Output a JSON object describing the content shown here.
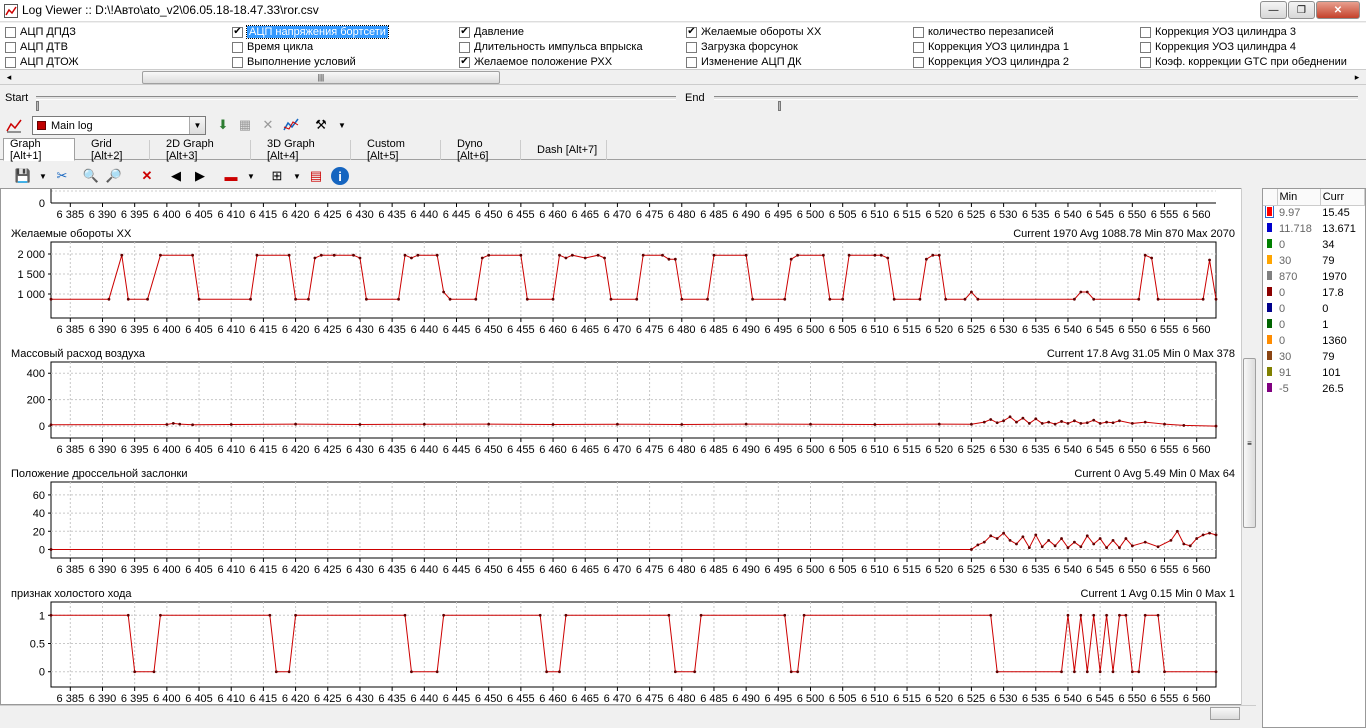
{
  "window": {
    "title": "Log Viewer :: D:\\!Авто\\ato_v2\\06.05.18-18.47.33\\ror.csv",
    "buttons": [
      "—",
      "❐",
      "✕"
    ]
  },
  "checkboxes": [
    {
      "label": "АЦП ДПДЗ",
      "checked": false
    },
    {
      "label": "АЦП ДТВ",
      "checked": false
    },
    {
      "label": "АЦП ДТОЖ",
      "checked": false
    },
    {
      "label": "АЦП напряжения бортсети",
      "checked": true,
      "selected": true
    },
    {
      "label": "Время цикла",
      "checked": false
    },
    {
      "label": "Выполнение условий",
      "checked": false
    },
    {
      "label": "Давление",
      "checked": true
    },
    {
      "label": "Длительность импульса впрыска",
      "checked": false
    },
    {
      "label": "Желаемое положение РХХ",
      "checked": true
    },
    {
      "label": "Желаемые обороты ХХ",
      "checked": true
    },
    {
      "label": "Загрузка форсунок",
      "checked": false
    },
    {
      "label": "Изменение АЦП ДК",
      "checked": false
    },
    {
      "label": "количество перезаписей",
      "checked": false
    },
    {
      "label": "Коррекция УОЗ цилиндра 1",
      "checked": false
    },
    {
      "label": "Коррекция УОЗ цилиндра 2",
      "checked": false
    },
    {
      "label": "Коррекция УОЗ цилиндра 3",
      "checked": false
    },
    {
      "label": "Коррекция УОЗ цилиндра 4",
      "checked": false
    },
    {
      "label": "Коэф. коррекции GTC при обеднении",
      "checked": false
    }
  ],
  "range": {
    "start_label": "Start",
    "end_label": "End"
  },
  "toolbar": {
    "log_selector": "Main log"
  },
  "tabs": [
    "Graph [Alt+1]",
    "Grid [Alt+2]",
    "2D Graph [Alt+3]",
    "3D Graph [Alt+4]",
    "Custom [Alt+5]",
    "Dyno [Alt+6]",
    "Dash [Alt+7]"
  ],
  "active_tab": 0,
  "colors": {
    "series": "#cc0000",
    "grid": "#c8c8c8",
    "selection": "#3399ff"
  },
  "xticks": [
    "6 385",
    "6 390",
    "6 395",
    "6 400",
    "6 405",
    "6 410",
    "6 415",
    "6 420",
    "6 425",
    "6 430",
    "6 435",
    "6 440",
    "6 445",
    "6 450",
    "6 455",
    "6 460",
    "6 465",
    "6 470",
    "6 475",
    "6 480",
    "6 485",
    "6 490",
    "6 495",
    "6 500",
    "6 505",
    "6 510",
    "6 515",
    "6 520",
    "6 525",
    "6 530",
    "6 535",
    "6 540",
    "6 545",
    "6 550",
    "6 555",
    "6 560"
  ],
  "top_panel": {
    "ytick": "0"
  },
  "chart_data": [
    {
      "type": "line",
      "title": "Желаемые обороты ХХ",
      "stats": "Current 1970 Avg 1088.78 Min 870 Max 2070",
      "yticks": [
        "2 000",
        "1 500",
        "1 000"
      ],
      "ylim": [
        500,
        2250
      ],
      "xlim": [
        6382,
        6563
      ],
      "series": [
        {
          "values": [
            [
              6382,
              870
            ],
            [
              6391,
              870
            ],
            [
              6393,
              1970
            ],
            [
              6394,
              870
            ],
            [
              6397,
              870
            ],
            [
              6399,
              1970
            ],
            [
              6404,
              1970
            ],
            [
              6405,
              870
            ],
            [
              6413,
              870
            ],
            [
              6414,
              1970
            ],
            [
              6419,
              1970
            ],
            [
              6420,
              870
            ],
            [
              6422,
              870
            ],
            [
              6423,
              1900
            ],
            [
              6424,
              1970
            ],
            [
              6426,
              1970
            ],
            [
              6429,
              1970
            ],
            [
              6430,
              1900
            ],
            [
              6431,
              870
            ],
            [
              6436,
              870
            ],
            [
              6437,
              1970
            ],
            [
              6438,
              1900
            ],
            [
              6439,
              1970
            ],
            [
              6442,
              1970
            ],
            [
              6443,
              1050
            ],
            [
              6444,
              870
            ],
            [
              6448,
              870
            ],
            [
              6449,
              1900
            ],
            [
              6450,
              1970
            ],
            [
              6455,
              1970
            ],
            [
              6456,
              870
            ],
            [
              6460,
              870
            ],
            [
              6461,
              1970
            ],
            [
              6462,
              1900
            ],
            [
              6463,
              1970
            ],
            [
              6465,
              1900
            ],
            [
              6467,
              1970
            ],
            [
              6468,
              1900
            ],
            [
              6469,
              870
            ],
            [
              6473,
              870
            ],
            [
              6474,
              1970
            ],
            [
              6477,
              1970
            ],
            [
              6478,
              1870
            ],
            [
              6479,
              1870
            ],
            [
              6480,
              870
            ],
            [
              6484,
              870
            ],
            [
              6485,
              1970
            ],
            [
              6490,
              1970
            ],
            [
              6491,
              870
            ],
            [
              6496,
              870
            ],
            [
              6497,
              1870
            ],
            [
              6498,
              1970
            ],
            [
              6502,
              1970
            ],
            [
              6503,
              870
            ],
            [
              6505,
              870
            ],
            [
              6506,
              1970
            ],
            [
              6510,
              1970
            ],
            [
              6511,
              1970
            ],
            [
              6512,
              1900
            ],
            [
              6513,
              870
            ],
            [
              6517,
              870
            ],
            [
              6518,
              1870
            ],
            [
              6519,
              1970
            ],
            [
              6520,
              1970
            ],
            [
              6521,
              870
            ],
            [
              6524,
              870
            ],
            [
              6525,
              1050
            ],
            [
              6526,
              870
            ],
            [
              6541,
              870
            ],
            [
              6542,
              1050
            ],
            [
              6543,
              1050
            ],
            [
              6544,
              870
            ],
            [
              6551,
              870
            ],
            [
              6552,
              1970
            ],
            [
              6553,
              1900
            ],
            [
              6554,
              870
            ],
            [
              6561,
              870
            ],
            [
              6562,
              1850
            ],
            [
              6563,
              870
            ],
            [
              6570,
              870
            ],
            [
              6571,
              1900
            ],
            [
              6572,
              870
            ],
            [
              6587,
              870
            ]
          ]
        }
      ]
    },
    {
      "type": "line",
      "title": "Массовый расход воздуха",
      "stats": "Current 17.8 Avg 31.05 Min 0 Max 378",
      "yticks": [
        "400",
        "200",
        "0"
      ],
      "ylim": [
        -60,
        470
      ],
      "xlim": [
        6382,
        6563
      ],
      "series": [
        {
          "values": [
            [
              6382,
              10
            ],
            [
              6400,
              12
            ],
            [
              6401,
              20
            ],
            [
              6402,
              15
            ],
            [
              6404,
              10
            ],
            [
              6410,
              12
            ],
            [
              6420,
              15
            ],
            [
              6430,
              12
            ],
            [
              6440,
              14
            ],
            [
              6450,
              15
            ],
            [
              6460,
              12
            ],
            [
              6470,
              14
            ],
            [
              6480,
              12
            ],
            [
              6490,
              15
            ],
            [
              6500,
              14
            ],
            [
              6510,
              12
            ],
            [
              6520,
              15
            ],
            [
              6525,
              14
            ],
            [
              6527,
              30
            ],
            [
              6528,
              50
            ],
            [
              6529,
              25
            ],
            [
              6530,
              40
            ],
            [
              6531,
              70
            ],
            [
              6532,
              30
            ],
            [
              6533,
              60
            ],
            [
              6534,
              20
            ],
            [
              6535,
              55
            ],
            [
              6536,
              20
            ],
            [
              6537,
              30
            ],
            [
              6538,
              15
            ],
            [
              6539,
              35
            ],
            [
              6540,
              20
            ],
            [
              6541,
              40
            ],
            [
              6542,
              20
            ],
            [
              6543,
              25
            ],
            [
              6544,
              45
            ],
            [
              6545,
              20
            ],
            [
              6546,
              30
            ],
            [
              6547,
              25
            ],
            [
              6548,
              40
            ],
            [
              6550,
              20
            ],
            [
              6552,
              30
            ],
            [
              6555,
              15
            ],
            [
              6558,
              5
            ],
            [
              6563,
              0
            ]
          ]
        }
      ]
    },
    {
      "type": "line",
      "title": "Положение дроссельной заслонки",
      "stats": "Current 0 Avg 5.49 Min 0 Max 64",
      "yticks": [
        "60",
        "40",
        "20",
        "0"
      ],
      "ylim": [
        -5,
        72
      ],
      "xlim": [
        6382,
        6563
      ],
      "series": [
        {
          "values": [
            [
              6382,
              0
            ],
            [
              6525,
              0
            ],
            [
              6526,
              5
            ],
            [
              6527,
              8
            ],
            [
              6528,
              15
            ],
            [
              6529,
              12
            ],
            [
              6530,
              18
            ],
            [
              6531,
              10
            ],
            [
              6532,
              6
            ],
            [
              6533,
              14
            ],
            [
              6534,
              2
            ],
            [
              6535,
              16
            ],
            [
              6536,
              3
            ],
            [
              6537,
              10
            ],
            [
              6538,
              4
            ],
            [
              6539,
              12
            ],
            [
              6540,
              2
            ],
            [
              6541,
              8
            ],
            [
              6542,
              3
            ],
            [
              6543,
              15
            ],
            [
              6544,
              6
            ],
            [
              6545,
              12
            ],
            [
              6546,
              2
            ],
            [
              6547,
              10
            ],
            [
              6548,
              2
            ],
            [
              6549,
              12
            ],
            [
              6550,
              4
            ],
            [
              6552,
              8
            ],
            [
              6554,
              3
            ],
            [
              6556,
              10
            ],
            [
              6557,
              20
            ],
            [
              6558,
              6
            ],
            [
              6559,
              4
            ],
            [
              6560,
              12
            ],
            [
              6561,
              16
            ],
            [
              6562,
              18
            ],
            [
              6563,
              16
            ]
          ]
        }
      ]
    },
    {
      "type": "line",
      "title": "признак холостого хода",
      "stats": "Current 1 Avg 0.15 Min 0 Max 1",
      "yticks": [
        "1",
        "0.5",
        "0"
      ],
      "ylim": [
        -0.2,
        1.2
      ],
      "xlim": [
        6382,
        6563
      ],
      "series": [
        {
          "values": [
            [
              6382,
              1
            ],
            [
              6394,
              1
            ],
            [
              6395,
              0
            ],
            [
              6398,
              0
            ],
            [
              6399,
              1
            ],
            [
              6416,
              1
            ],
            [
              6417,
              0
            ],
            [
              6419,
              0
            ],
            [
              6420,
              1
            ],
            [
              6437,
              1
            ],
            [
              6438,
              0
            ],
            [
              6442,
              0
            ],
            [
              6443,
              1
            ],
            [
              6458,
              1
            ],
            [
              6459,
              0
            ],
            [
              6461,
              0
            ],
            [
              6462,
              1
            ],
            [
              6478,
              1
            ],
            [
              6479,
              0
            ],
            [
              6482,
              0
            ],
            [
              6483,
              1
            ],
            [
              6496,
              1
            ],
            [
              6497,
              0
            ],
            [
              6498,
              0
            ],
            [
              6499,
              1
            ],
            [
              6528,
              1
            ],
            [
              6529,
              0
            ],
            [
              6539,
              0
            ],
            [
              6540,
              1
            ],
            [
              6541,
              0
            ],
            [
              6542,
              1
            ],
            [
              6543,
              0
            ],
            [
              6544,
              1
            ],
            [
              6545,
              0
            ],
            [
              6546,
              1
            ],
            [
              6547,
              0
            ],
            [
              6548,
              1
            ],
            [
              6549,
              1
            ],
            [
              6550,
              0
            ],
            [
              6551,
              0
            ],
            [
              6552,
              1
            ],
            [
              6554,
              1
            ],
            [
              6555,
              0
            ],
            [
              6563,
              0
            ]
          ]
        }
      ]
    }
  ],
  "side_table": {
    "headers": [
      "Min",
      "Curr"
    ],
    "rows": [
      {
        "color": "#ff0000",
        "min": "9.97",
        "curr": "15.45",
        "selected": true
      },
      {
        "color": "#0000cc",
        "min": "11.718",
        "curr": "13.671"
      },
      {
        "color": "#008000",
        "min": "0",
        "curr": "34"
      },
      {
        "color": "#ffa500",
        "min": "30",
        "curr": "79"
      },
      {
        "color": "#808080",
        "min": "870",
        "curr": "1970"
      },
      {
        "color": "#8b0000",
        "min": "0",
        "curr": "17.8"
      },
      {
        "color": "#00008b",
        "min": "0",
        "curr": "0"
      },
      {
        "color": "#006400",
        "min": "0",
        "curr": "1"
      },
      {
        "color": "#ff8c00",
        "min": "0",
        "curr": "1360"
      },
      {
        "color": "#8b4513",
        "min": "30",
        "curr": "79"
      },
      {
        "color": "#808000",
        "min": "91",
        "curr": "101"
      },
      {
        "color": "#800080",
        "min": "-5",
        "curr": "26.5"
      }
    ]
  }
}
